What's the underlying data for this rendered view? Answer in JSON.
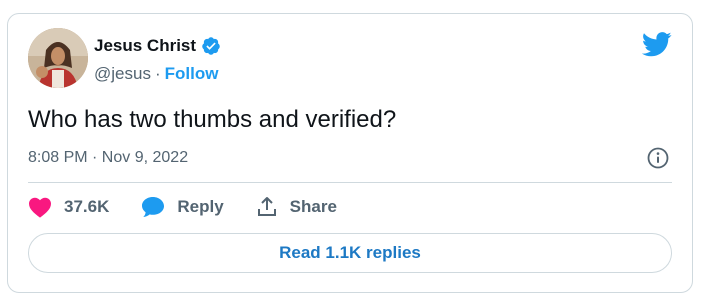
{
  "tweet": {
    "author_name": "Jesus Christ",
    "author_handle": "@jesus",
    "separator": "·",
    "follow_label": "Follow",
    "text": "Who has two thumbs and verified?",
    "timestamp": "8:08 PM · Nov 9, 2022",
    "like_count": "37.6K",
    "reply_label": "Reply",
    "share_label": "Share",
    "read_replies_label": "Read 1.1K replies"
  },
  "colors": {
    "accent": "#1d9bf0",
    "like": "#f91880",
    "text": "#0f1419",
    "muted": "#536471",
    "border": "#cfd9de"
  },
  "icons": {
    "verified": "verified-badge-icon",
    "brand": "twitter-bird-icon",
    "info": "info-icon",
    "like": "heart-icon",
    "reply": "speech-bubble-icon",
    "share": "upload-share-icon"
  }
}
